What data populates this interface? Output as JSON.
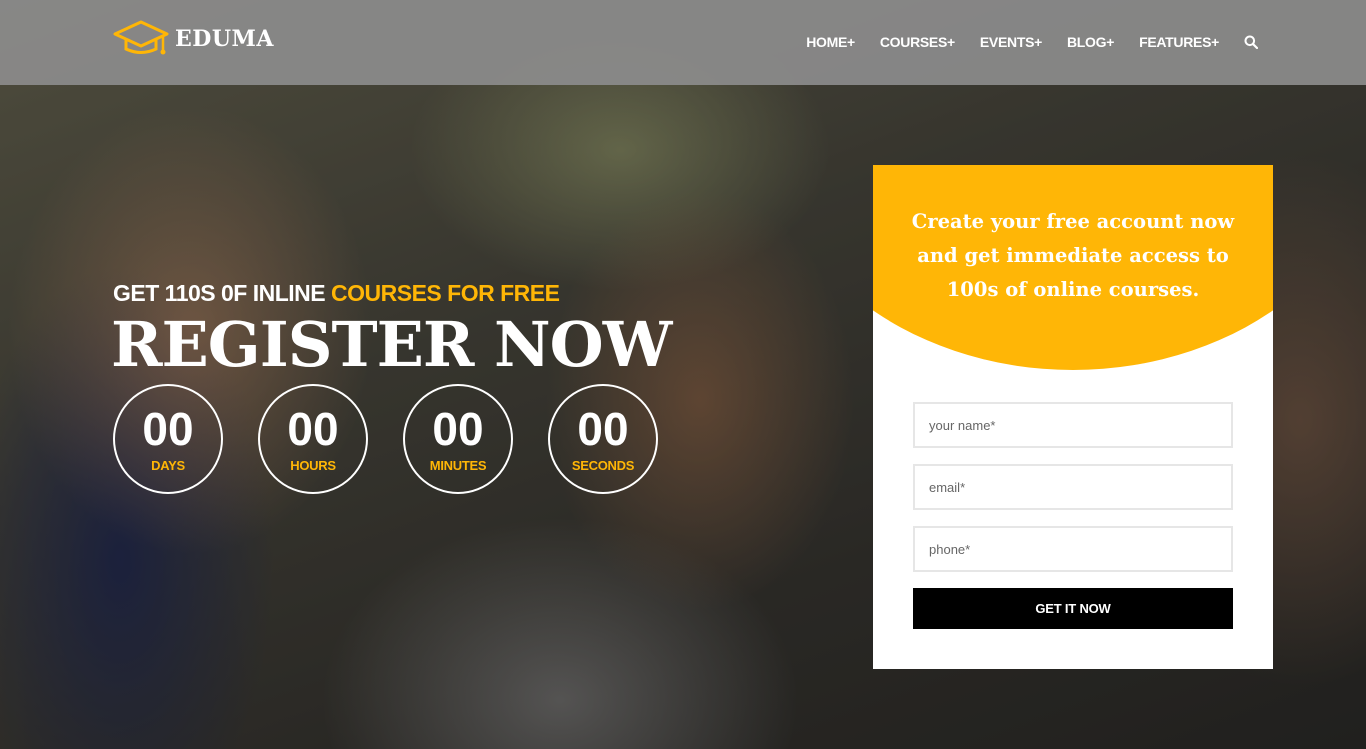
{
  "brand": {
    "name": "EDUMA",
    "accent_color": "#ffb606"
  },
  "nav": {
    "items": [
      {
        "label": "HOME+"
      },
      {
        "label": "COURSES+"
      },
      {
        "label": "EVENTS+"
      },
      {
        "label": "BLOG+"
      },
      {
        "label": "FEATURES+"
      }
    ],
    "search_icon": "search-icon"
  },
  "hero": {
    "tagline_prefix": "GET 110S 0F INLINE ",
    "tagline_accent": "COURSES FOR FREE",
    "headline": "REGISTER NOW",
    "countdown": [
      {
        "value": "00",
        "label": "DAYS"
      },
      {
        "value": "00",
        "label": "HOURS"
      },
      {
        "value": "00",
        "label": "MINUTES"
      },
      {
        "value": "00",
        "label": "SECONDS"
      }
    ]
  },
  "register_form": {
    "title": "Create your free account now and get immediate access to 100s of online courses.",
    "name_placeholder": "your name*",
    "email_placeholder": "email*",
    "phone_placeholder": "phone*",
    "submit_label": "GET IT NOW"
  }
}
